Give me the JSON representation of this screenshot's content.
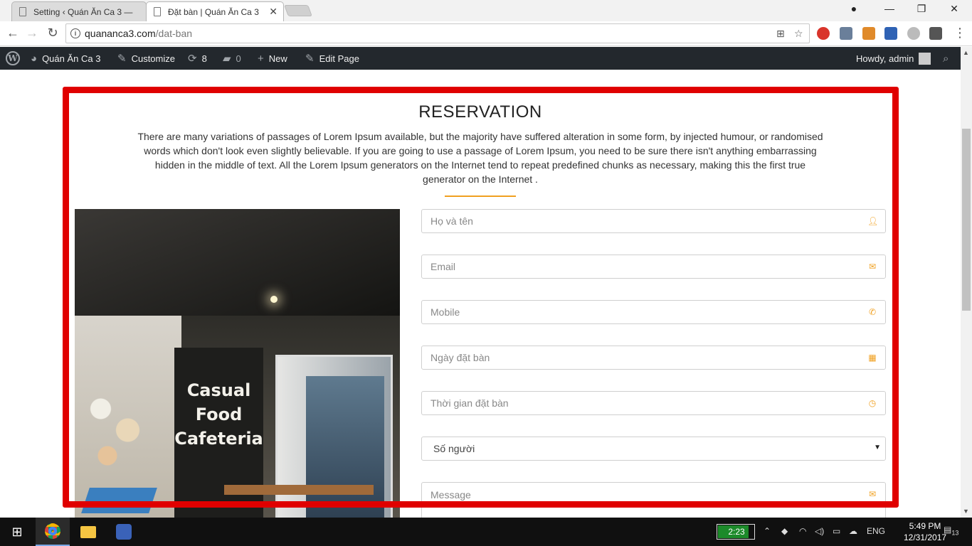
{
  "browser": {
    "tabs": [
      {
        "title": "Setting ‹ Quán Ăn Ca 3 —",
        "active": false
      },
      {
        "title": "Đặt bàn | Quán Ăn Ca 3",
        "active": true
      }
    ],
    "url_host": "quananca3.com",
    "url_path": "/dat-ban"
  },
  "adminbar": {
    "site_name": "Quán Ăn Ca 3",
    "customize": "Customize",
    "updates_count": "8",
    "comments_count": "0",
    "new_label": "New",
    "edit_page": "Edit Page",
    "howdy": "Howdy, admin"
  },
  "reservation": {
    "title": "RESERVATION",
    "description": "There are many variations of passages of Lorem Ipsum available, but the majority have suffered alteration in some form, by injected humour, or randomised words which don't look even slightly believable. If you are going to use a passage of Lorem Ipsum, you need to be sure there isn't anything embarrassing hidden in the middle of text. All the Lorem Ipsum generators on the Internet tend to repeat predefined chunks as necessary, making this the first true generator on the Internet .",
    "accent_color": "#f0a020",
    "frame_color": "#e00000",
    "photo_sign": [
      "Casual",
      "Food",
      "Cafeteria"
    ],
    "fields": {
      "name_placeholder": "Họ và tên",
      "email_placeholder": "Email",
      "mobile_placeholder": "Mobile",
      "date_placeholder": "Ngày đặt bàn",
      "time_placeholder": "Thời gian đặt bàn",
      "guests_selected": "Số người",
      "message_placeholder": "Message"
    }
  },
  "taskbar": {
    "battery_time": "2:23",
    "language": "ENG",
    "time": "5:49 PM",
    "date": "12/31/2017",
    "notifications": "13"
  }
}
